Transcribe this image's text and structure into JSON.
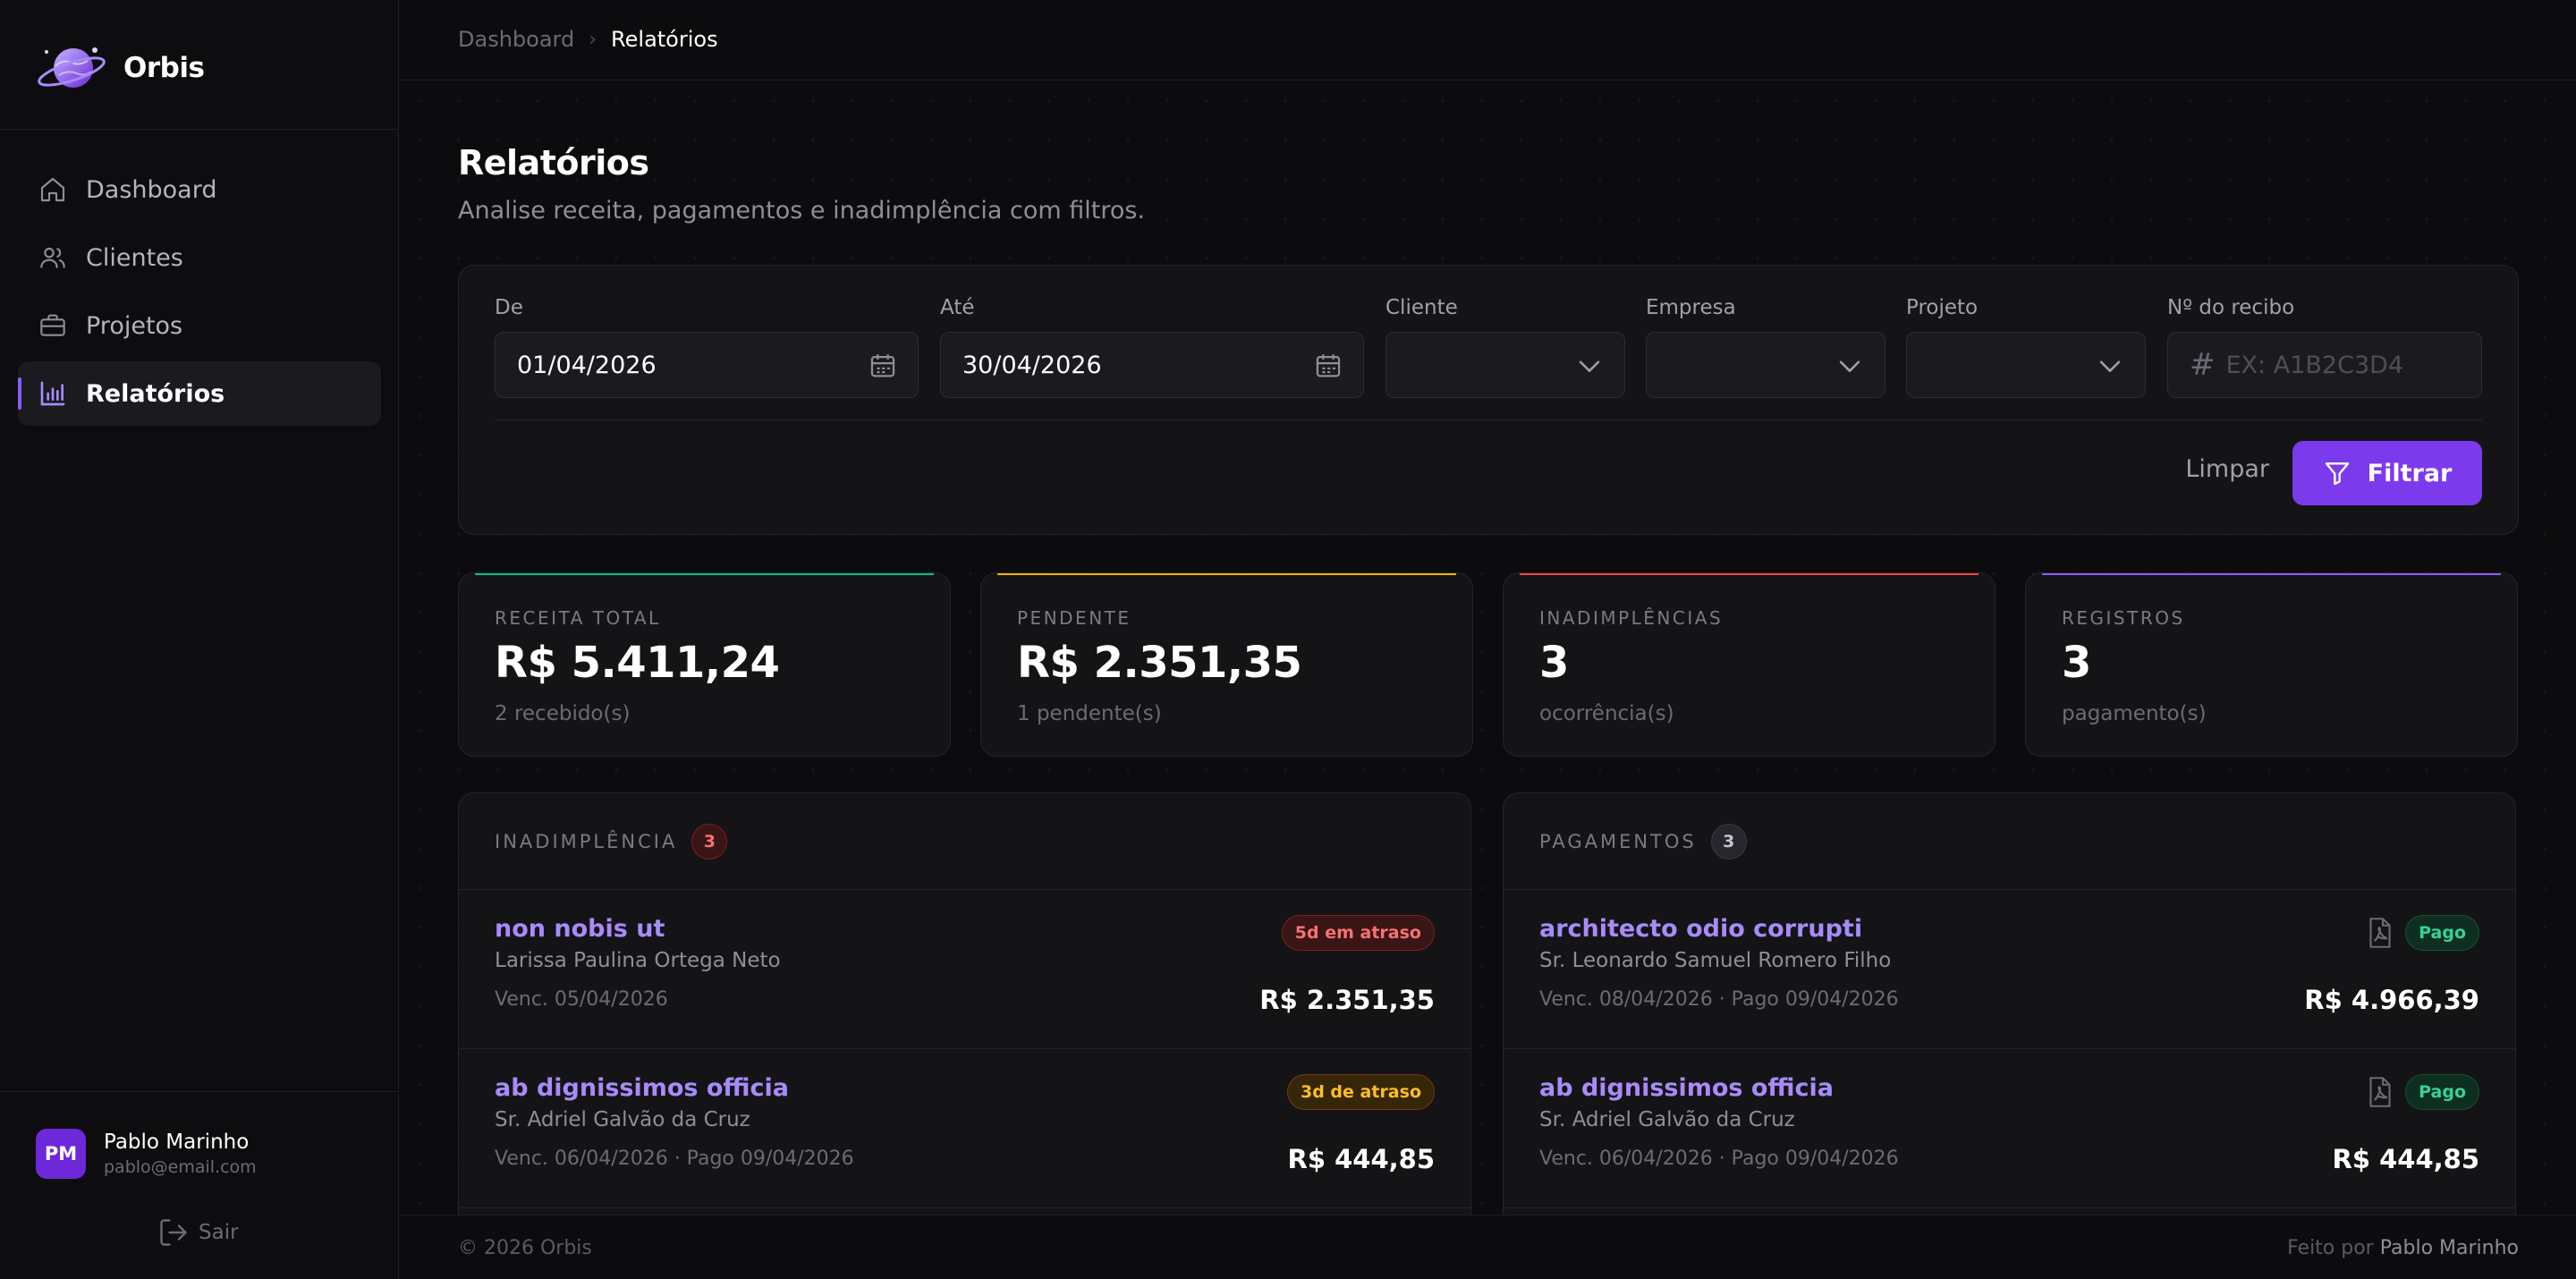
{
  "app": {
    "name": "Orbis"
  },
  "nav": {
    "items": [
      {
        "label": "Dashboard",
        "icon": "home-icon"
      },
      {
        "label": "Clientes",
        "icon": "users-icon"
      },
      {
        "label": "Projetos",
        "icon": "briefcase-icon"
      },
      {
        "label": "Relatórios",
        "icon": "bar-chart-icon",
        "active": true
      }
    ]
  },
  "user": {
    "initials": "PM",
    "name": "Pablo Marinho",
    "email": "pablo@email.com",
    "logout_label": "Sair"
  },
  "breadcrumb": {
    "parent": "Dashboard",
    "current": "Relatórios"
  },
  "page": {
    "title": "Relatórios",
    "subtitle": "Analise receita, pagamentos e inadimplência com filtros."
  },
  "filters": {
    "from": {
      "label": "De",
      "value": "01/04/2026"
    },
    "to": {
      "label": "Até",
      "value": "30/04/2026"
    },
    "client": {
      "label": "Cliente",
      "value": ""
    },
    "company": {
      "label": "Empresa",
      "value": ""
    },
    "project": {
      "label": "Projeto",
      "value": ""
    },
    "receipt": {
      "label": "Nº do recibo",
      "placeholder": "EX: A1B2C3D4"
    },
    "clear_label": "Limpar",
    "filter_label": "Filtrar"
  },
  "stats": [
    {
      "label": "RECEITA TOTAL",
      "value": "R$ 5.411,24",
      "sub": "2 recebido(s)",
      "accent": "#10b981"
    },
    {
      "label": "PENDENTE",
      "value": "R$ 2.351,35",
      "sub": "1 pendente(s)",
      "accent": "#eab308"
    },
    {
      "label": "INADIMPLÊNCIAS",
      "value": "3",
      "sub": "ocorrência(s)",
      "accent": "#ef4444"
    },
    {
      "label": "REGISTROS",
      "value": "3",
      "sub": "pagamento(s)",
      "accent": "#8b5cf6"
    }
  ],
  "delinquency": {
    "title": "INADIMPLÊNCIA",
    "count": "3",
    "rows": [
      {
        "title": "non nobis ut",
        "person": "Larissa Paulina Ortega Neto",
        "dates": "Venc. 05/04/2026",
        "amount": "R$ 2.351,35",
        "tag": "5d em atraso"
      },
      {
        "title": "ab dignissimos officia",
        "person": "Sr. Adriel Galvão da Cruz",
        "dates": "Venc. 06/04/2026 · Pago 09/04/2026",
        "amount": "R$ 444,85",
        "tag": "3d de atraso"
      }
    ]
  },
  "payments": {
    "title": "PAGAMENTOS",
    "count": "3",
    "rows": [
      {
        "title": "architecto odio corrupti",
        "person": "Sr. Leonardo Samuel Romero Filho",
        "dates": "Venc. 08/04/2026 · Pago 09/04/2026",
        "amount": "R$ 4.966,39",
        "tag": "Pago"
      },
      {
        "title": "ab dignissimos officia",
        "person": "Sr. Adriel Galvão da Cruz",
        "dates": "Venc. 06/04/2026 · Pago 09/04/2026",
        "amount": "R$ 444,85",
        "tag": "Pago"
      }
    ]
  },
  "footer": {
    "copyright": "© 2026 Orbis",
    "made_by_label": "Feito por",
    "author": "Pablo Marinho"
  }
}
